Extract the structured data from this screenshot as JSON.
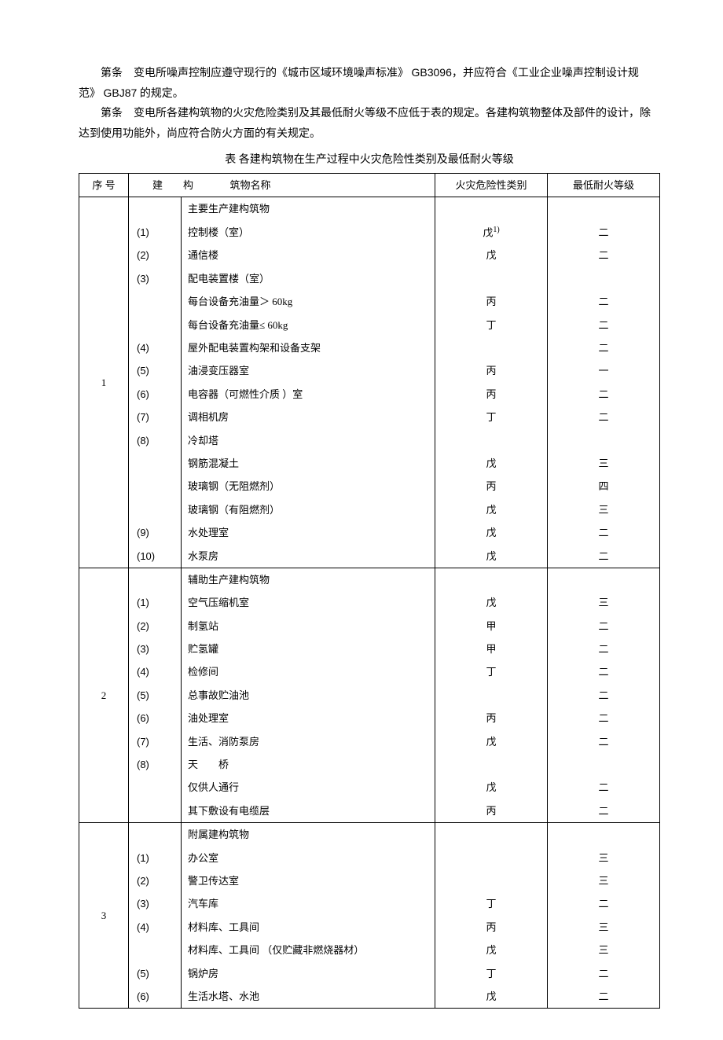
{
  "paragraphs": {
    "p1_a": "第条　变电所噪声控制应遵守现行的《城市区域环境噪声标准》",
    "p1_gb1": "GB3096",
    "p1_b": "，并应符合《工业企业噪声控制设计规范》",
    "p1_gb2": "GBJ87",
    "p1_c": " 的规定。",
    "p2": "第条　变电所各建构筑物的火灾危险类别及其最低耐火等级不应低于表的规定。各建构筑物整体及部件的设计，除达到使用功能外，尚应符合防火方面的有关规定。"
  },
  "caption": "表 各建构筑物在生产过程中火灾危险性类别及最低耐火等级",
  "headers": {
    "seq": "序 号",
    "name_a": "建　　构",
    "name_b": "筑物名称",
    "hazard": "火灾危险性类别",
    "fire": "最低耐火等级"
  },
  "section1": {
    "seq": "1",
    "title": "主要生产建构筑物",
    "rows": [
      {
        "sub": "(1)",
        "name": "控制楼（室）",
        "haz": "戊",
        "haz_sup": "1)",
        "fire": "二"
      },
      {
        "sub": "(2)",
        "name": "通信楼",
        "haz": "戊",
        "fire": "二"
      },
      {
        "sub": "(3)",
        "name": "配电装置楼（室）",
        "haz": "",
        "fire": ""
      },
      {
        "sub": "",
        "name": "每台设备充油量＞ 60kg",
        "haz": "丙",
        "fire": "二",
        "indent": true
      },
      {
        "sub": "",
        "name": "每台设备充油量≤ 60kg",
        "haz": "丁",
        "fire": "二",
        "indent": true
      },
      {
        "sub": "(4)",
        "name": "屋外配电装置构架和设备支架",
        "haz": "",
        "fire": "二"
      },
      {
        "sub": "(5)",
        "name": "油浸变压器室",
        "haz": "丙",
        "fire": "一"
      },
      {
        "sub": "(6)",
        "name": "电容器（可燃性介质 ）室",
        "haz": "丙",
        "fire": "二"
      },
      {
        "sub": "(7)",
        "name": "调相机房",
        "haz": "丁",
        "fire": "二"
      },
      {
        "sub": "(8)",
        "name": "冷却塔",
        "haz": "",
        "fire": ""
      },
      {
        "sub": "",
        "name": "钢筋混凝土",
        "haz": "戊",
        "fire": "三",
        "indent": true
      },
      {
        "sub": "",
        "name": "玻璃钢（无阻燃剂）",
        "haz": "丙",
        "fire": "四",
        "indent": true
      },
      {
        "sub": "",
        "name": "玻璃钢（有阻燃剂）",
        "haz": "戊",
        "fire": "三",
        "indent": true
      },
      {
        "sub": "(9)",
        "name": "水处理室",
        "haz": "戊",
        "fire": "二"
      },
      {
        "sub": "(10)",
        "name": "水泵房",
        "haz": "戊",
        "fire": "二"
      }
    ]
  },
  "section2": {
    "seq": "2",
    "title": "辅助生产建构筑物",
    "rows": [
      {
        "sub": "(1)",
        "name": "空气压缩机室",
        "haz": "戊",
        "fire": "三"
      },
      {
        "sub": "(2)",
        "name": "制氢站",
        "haz": "甲",
        "fire": "二"
      },
      {
        "sub": "(3)",
        "name": "贮氢罐",
        "haz": "甲",
        "fire": "二"
      },
      {
        "sub": "(4)",
        "name": "检修间",
        "haz": "丁",
        "fire": "二"
      },
      {
        "sub": "(5)",
        "name": "总事故贮油池",
        "haz": "",
        "fire": "二"
      },
      {
        "sub": "(6)",
        "name": "油处理室",
        "haz": "丙",
        "fire": "二"
      },
      {
        "sub": "(7)",
        "name": "生活、消防泵房",
        "haz": "戊",
        "fire": "二"
      },
      {
        "sub": "(8)",
        "name": "天　　桥",
        "haz": "",
        "fire": ""
      },
      {
        "sub": "",
        "name": "仅供人通行",
        "haz": "戊",
        "fire": "二",
        "indent": true
      },
      {
        "sub": "",
        "name": "其下敷设有电缆层",
        "haz": "丙",
        "fire": "二",
        "indent": true
      }
    ]
  },
  "section3": {
    "seq": "3",
    "title": "附属建构筑物",
    "rows": [
      {
        "sub": "(1)",
        "name": "办公室",
        "haz": "",
        "fire": "三"
      },
      {
        "sub": "(2)",
        "name": "警卫传达室",
        "haz": "",
        "fire": "三"
      },
      {
        "sub": "(3)",
        "name": "汽车库",
        "haz": "丁",
        "fire": "二"
      },
      {
        "sub": "(4)",
        "name": "材料库、工具间",
        "haz": "丙",
        "fire": "三"
      },
      {
        "sub": "",
        "name": "材料库、工具间 （仅贮藏非燃烧器材）",
        "haz": "戊",
        "fire": "三",
        "indent": true
      },
      {
        "sub": "(5)",
        "name": "锅炉房",
        "haz": "丁",
        "fire": "二"
      },
      {
        "sub": "(6)",
        "name": "生活水塔、水池",
        "haz": "戊",
        "fire": "二"
      }
    ]
  }
}
